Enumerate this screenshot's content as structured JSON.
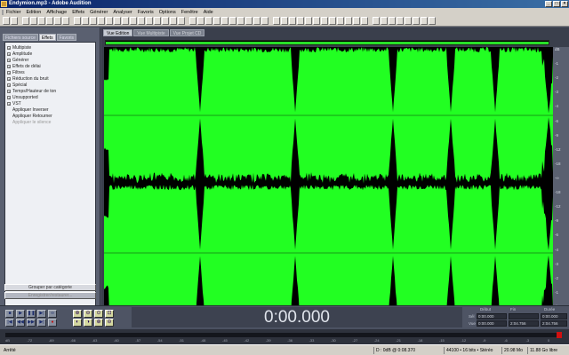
{
  "window": {
    "title": "Endymion.mp3 - Adobe Audition"
  },
  "menu": [
    "Fichier",
    "Edition",
    "Affichage",
    "Effets",
    "Générer",
    "Analyser",
    "Favoris",
    "Options",
    "Fenêtre",
    "Aide"
  ],
  "left_panel": {
    "tabs": [
      "Fichiers source",
      "Effets",
      "Favoris"
    ],
    "tree": [
      {
        "label": "Multipiste",
        "child": false,
        "disabled": false
      },
      {
        "label": "Amplitude",
        "child": false,
        "disabled": false
      },
      {
        "label": "Générer",
        "child": false,
        "disabled": false
      },
      {
        "label": "Effets de délai",
        "child": false,
        "disabled": false
      },
      {
        "label": "Filtres",
        "child": false,
        "disabled": false
      },
      {
        "label": "Réduction du bruit",
        "child": false,
        "disabled": false
      },
      {
        "label": "Spécial",
        "child": false,
        "disabled": false
      },
      {
        "label": "Temps/Hauteur de ton",
        "child": false,
        "disabled": false
      },
      {
        "label": "Unsupported",
        "child": false,
        "disabled": false
      },
      {
        "label": "VST",
        "child": false,
        "disabled": false
      },
      {
        "label": "Appliquer Inverser",
        "child": true,
        "disabled": false
      },
      {
        "label": "Appliquer Retourner",
        "child": true,
        "disabled": false
      },
      {
        "label": "Appliquer le silence",
        "child": true,
        "disabled": true
      }
    ],
    "buttons": [
      "Grouper par catégorie",
      "Enregistrer/restaurer..."
    ]
  },
  "editor": {
    "view_tabs": [
      "Vue Edition",
      "Vue Multipiste",
      "Vue Projet CD"
    ],
    "db_scale": [
      "dB",
      "-1",
      "-2",
      "-3",
      "-4",
      "-6",
      "-9",
      "-12",
      "-18",
      "-∞",
      "-18",
      "-12",
      "-9",
      "-6",
      "-4",
      "-3",
      "-2",
      "-1",
      "dB"
    ],
    "time_ruler": [
      "hms",
      "10.0",
      "20.0",
      "30.0",
      "40.0",
      "50.0",
      "1:00.0",
      "1:10.0",
      "1:20.0",
      "1:30.0",
      "1:40.0",
      "1:50.0",
      "2:00.0",
      "2:10.0",
      "2:20.0",
      "2:30.0",
      "2:40.0",
      "2:50.0",
      "3:00.0",
      "3:10.0",
      "3:20.0",
      "3:30.0",
      "3:40.0",
      "3:50.0",
      "4:00.0",
      "hms"
    ],
    "waveform_color": "#22ff22"
  },
  "transport": {
    "time": "0:00.000",
    "selection_header": {
      "start": "Début",
      "end": "Fin",
      "length": "Durée"
    },
    "sel_label": "Sél",
    "view_label": "Vue",
    "sel_start": "0:00.000",
    "sel_end": "",
    "sel_length": "0:00.000",
    "view_start": "0:00.000",
    "view_end": "2:04.756",
    "view_length": "2:04.756"
  },
  "level_meter": {
    "ticks": [
      "dB",
      "-72",
      "-69",
      "-66",
      "-63",
      "-60",
      "-57",
      "-54",
      "-51",
      "-48",
      "-45",
      "-42",
      "-39",
      "-36",
      "-33",
      "-30",
      "-27",
      "-24",
      "-21",
      "-18",
      "-15",
      "-12",
      "-9",
      "-6",
      "-3",
      "0"
    ]
  },
  "status": {
    "state": "Arrêté",
    "level": "D : 0dB @ 0:08.370",
    "format": "44100 • 16 bits • Stéréo",
    "size": "20.98 Mo",
    "free": "11.88 Go libre"
  }
}
